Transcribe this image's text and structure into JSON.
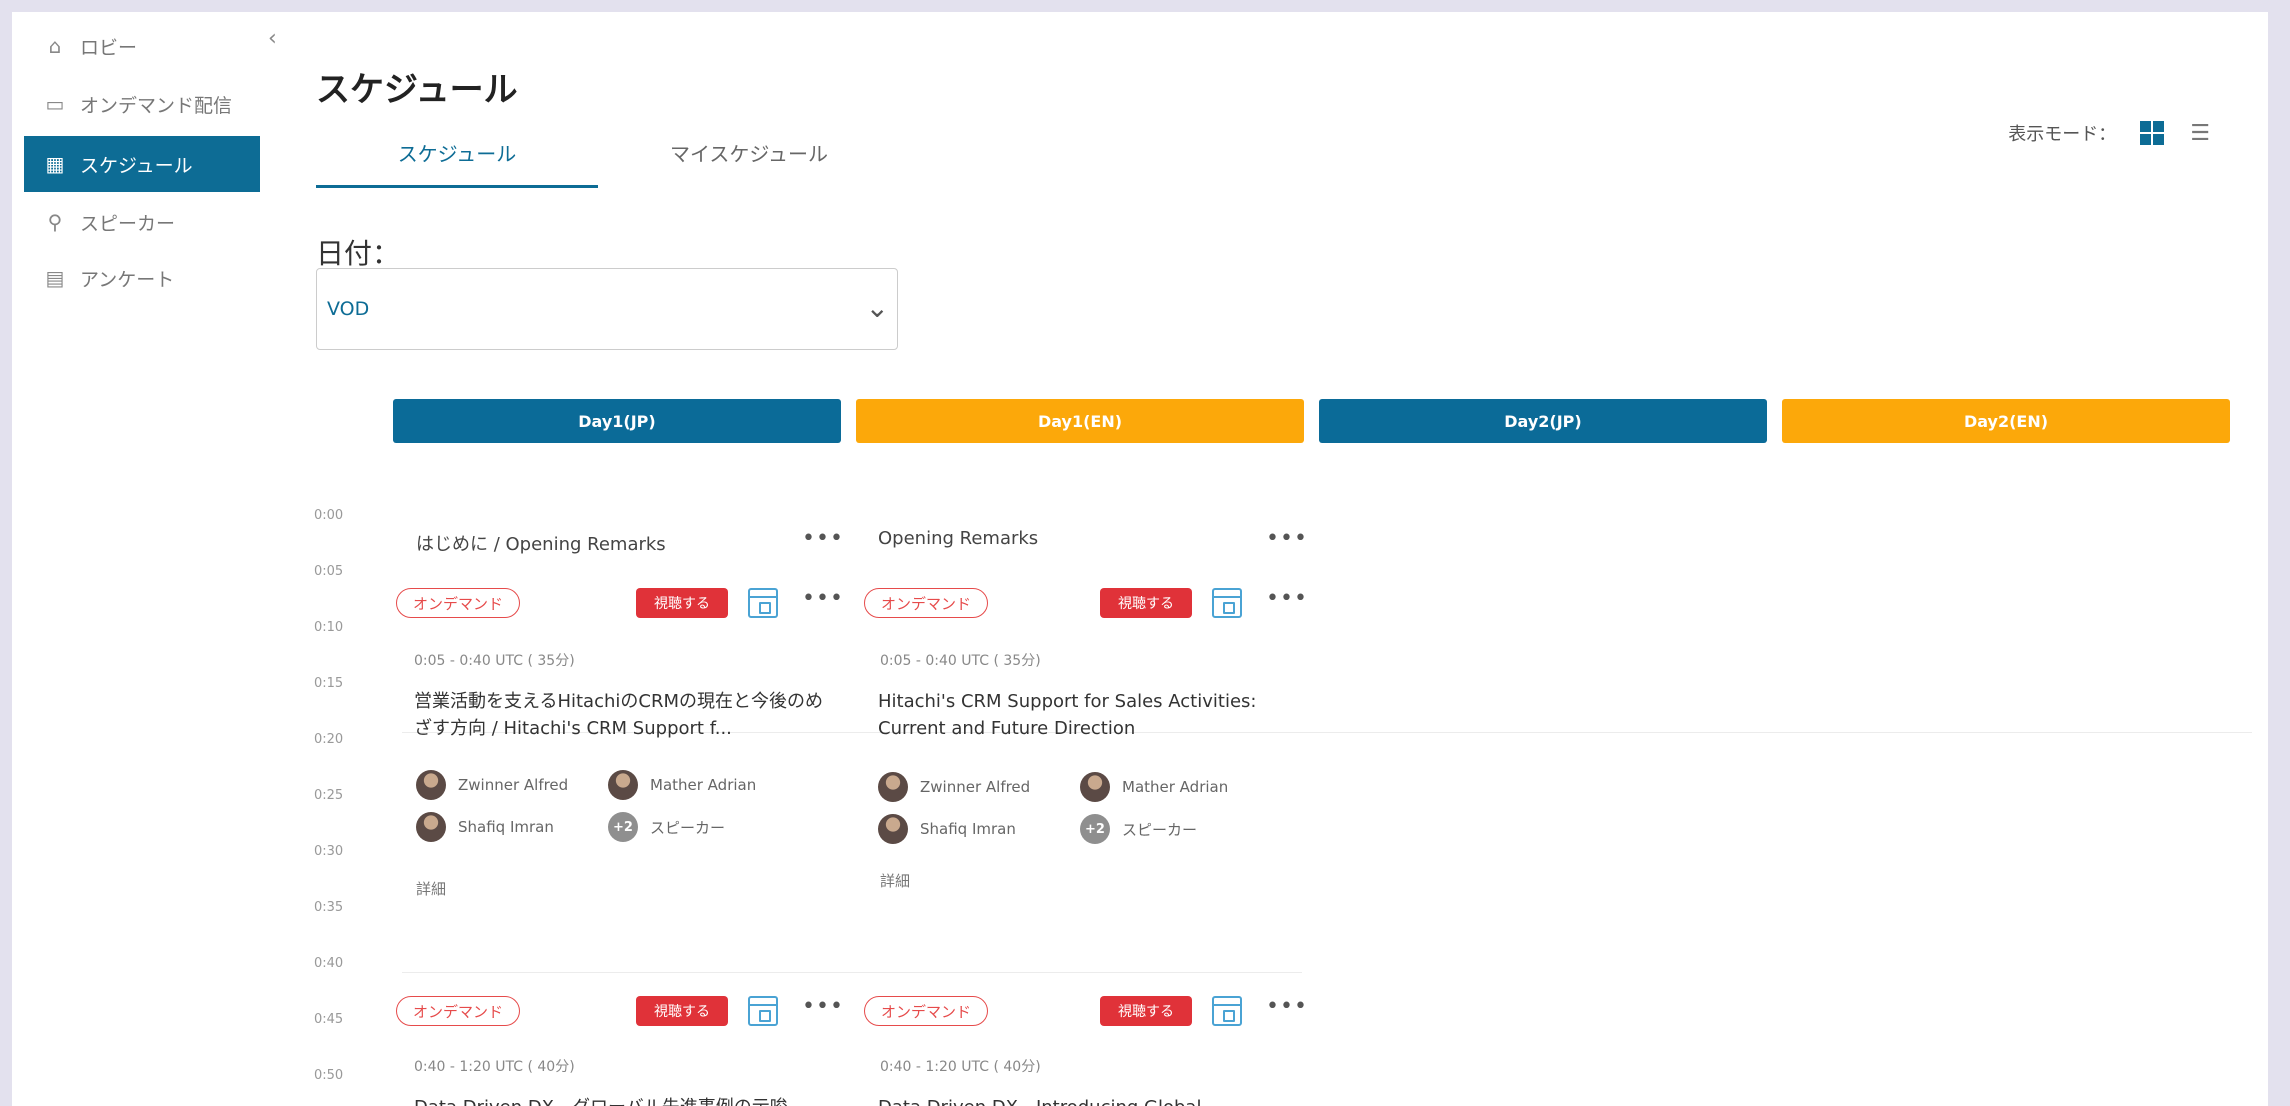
{
  "sidebar": {
    "collapse": "‹",
    "items": [
      {
        "label": "ロビー",
        "icon": "home-icon"
      },
      {
        "label": "オンデマンド配信",
        "icon": "monitor-icon"
      },
      {
        "label": "スケジュール",
        "icon": "calendar-grid-icon"
      },
      {
        "label": "スピーカー",
        "icon": "podium-icon"
      },
      {
        "label": "アンケート",
        "icon": "survey-icon"
      }
    ]
  },
  "header": {
    "title": "スケジュール",
    "tabs": [
      "スケジュール",
      "マイスケジュール"
    ],
    "view_mode_label": "表示モード：",
    "list_icon": "☰"
  },
  "filter": {
    "date_label": "日付：",
    "date_value": "VOD"
  },
  "day_tabs": [
    "Day1(JP)",
    "Day1(EN)",
    "Day2(JP)",
    "Day2(EN)"
  ],
  "times": [
    "0:00",
    "0:05",
    "0:10",
    "0:15",
    "0:20",
    "0:25",
    "0:30",
    "0:35",
    "0:40",
    "0:45",
    "0:50"
  ],
  "cards": {
    "c1": {
      "head": "はじめに / Opening Remarks",
      "badge": "オンデマンド",
      "view": "視聴する",
      "time": "0:05 - 0:40 UTC ( 35分)",
      "title": "営業活動を支えるHitachiのCRMの現在と今後のめざす方向 / Hitachi's CRM Support f...",
      "speakers": [
        "Zwinner Alfred",
        "Mather Adrian",
        "Shafiq Imran"
      ],
      "more_count": "+2",
      "more_label": "スピーカー",
      "details": "詳細"
    },
    "c2": {
      "head": "Opening Remarks",
      "badge": "オンデマンド",
      "view": "視聴する",
      "time": "0:05 - 0:40 UTC ( 35分)",
      "title": "Hitachi's CRM Support for Sales Activities: Current and Future Direction",
      "speakers": [
        "Zwinner Alfred",
        "Mather Adrian",
        "Shafiq Imran"
      ],
      "more_count": "+2",
      "more_label": "スピーカー",
      "details": "詳細"
    },
    "c3": {
      "badge": "オンデマンド",
      "view": "視聴する",
      "time": "0:40 - 1:20 UTC ( 40分)",
      "title": "Data Driven DX - グローバル先進事例の示唆"
    },
    "c4": {
      "badge": "オンデマンド",
      "view": "視聴する",
      "time": "0:40 - 1:20 UTC ( 40分)",
      "title": "Data Driven DX - Introducing Global"
    }
  },
  "more_icon": "•••",
  "colors": {
    "primary": "#0d6c95",
    "orange": "#fca80a",
    "red": "#e03239"
  }
}
